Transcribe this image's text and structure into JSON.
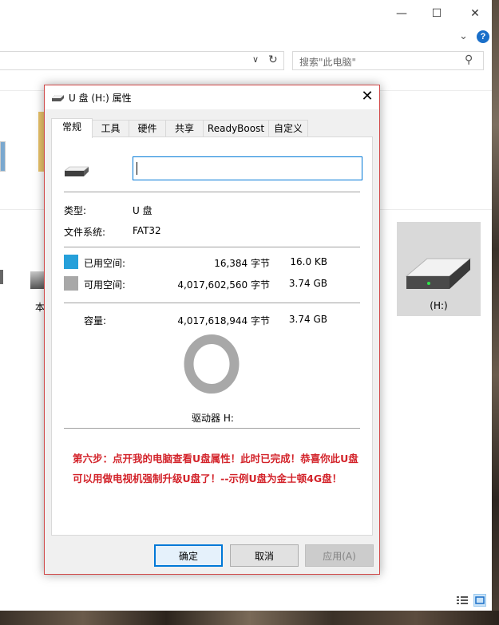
{
  "explorer": {
    "search_placeholder": "搜索\"此电脑\"",
    "partial_label": "本",
    "drive_tile_label": "(H:)"
  },
  "dialog": {
    "title": "U 盘 (H:) 属性",
    "tabs": [
      "常规",
      "工具",
      "硬件",
      "共享",
      "ReadyBoost",
      "自定义"
    ],
    "active_tab": "常规",
    "volume_label_value": "",
    "type_label": "类型:",
    "type_value": "U 盘",
    "fs_label": "文件系统:",
    "fs_value": "FAT32",
    "used_label": "已用空间:",
    "used_bytes": "16,384 字节",
    "used_size": "16.0 KB",
    "free_label": "可用空间:",
    "free_bytes": "4,017,602,560 字节",
    "free_size": "3.74 GB",
    "capacity_label": "容量:",
    "capacity_bytes": "4,017,618,944 字节",
    "capacity_size": "3.74 GB",
    "drive_label": "驱动器 H:",
    "used_fraction": 4e-06,
    "note": "第六步：点开我的电脑查看U盘属性！此时已完成！恭喜你此U盘可以用做电视机强制升级U盘了！--示例U盘为金士顿4G盘！",
    "buttons": {
      "ok": "确定",
      "cancel": "取消",
      "apply": "应用(A)"
    }
  },
  "colors": {
    "used": "#26a0da",
    "free": "#a8a8a8",
    "note": "#d3232a",
    "dialog_border": "#d04848"
  }
}
